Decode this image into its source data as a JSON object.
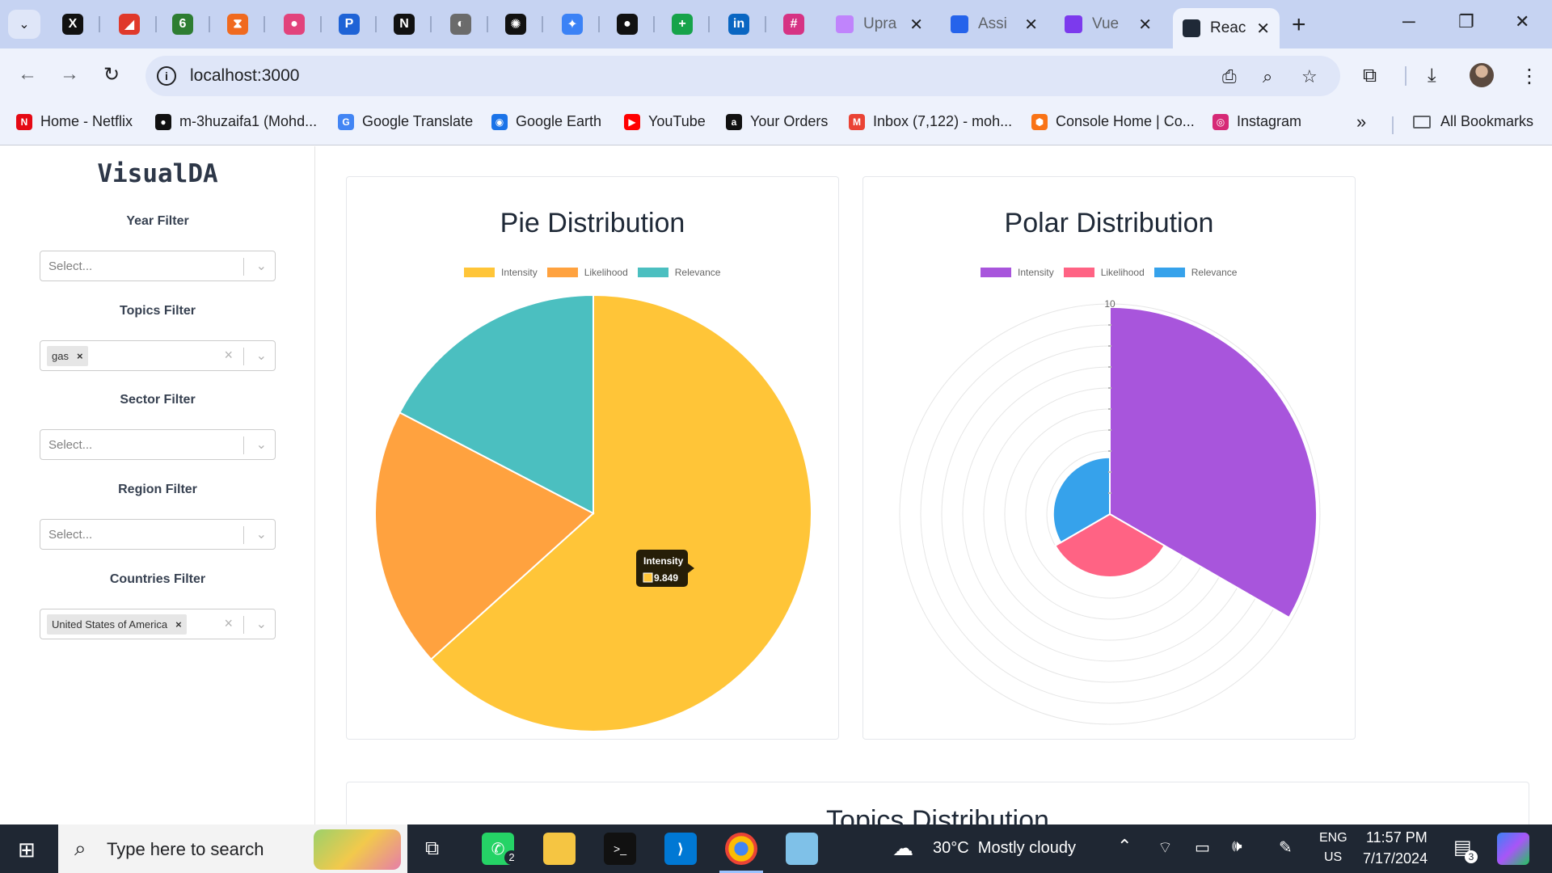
{
  "browser": {
    "pinned_tabs": [
      {
        "name": "x",
        "glyph": "X",
        "color": "#111111"
      },
      {
        "name": "ads",
        "glyph": "◢",
        "color": "#e0392b"
      },
      {
        "name": "gitlab",
        "glyph": "6",
        "color": "#2e7d32"
      },
      {
        "name": "hourglass",
        "glyph": "⧗",
        "color": "#f06a1f"
      },
      {
        "name": "figma",
        "glyph": "●",
        "color": "#e2437c"
      },
      {
        "name": "paypal",
        "glyph": "P",
        "color": "#1f63d6"
      },
      {
        "name": "notion",
        "glyph": "N",
        "color": "#111111"
      },
      {
        "name": "globe",
        "glyph": "◐",
        "color": "#6b6b6b"
      },
      {
        "name": "openai",
        "glyph": "✺",
        "color": "#111111"
      },
      {
        "name": "gemini",
        "glyph": "✦",
        "color": "#3b82f6"
      },
      {
        "name": "github",
        "glyph": "●",
        "color": "#111111"
      },
      {
        "name": "sheets-plus",
        "glyph": "+",
        "color": "#16a34a"
      },
      {
        "name": "linkedin",
        "glyph": "in",
        "color": "#0a66c2"
      },
      {
        "name": "slack",
        "glyph": "#",
        "color": "#d63384"
      }
    ],
    "tabs": [
      {
        "title": "Upra",
        "fav": "#c084fc"
      },
      {
        "title": "Assi",
        "fav": "#2563eb"
      },
      {
        "title": "Vue",
        "fav": "#7c3aed"
      },
      {
        "title": "Reac",
        "fav": "#1f2937"
      }
    ],
    "url": "localhost:3000",
    "bookmarks": [
      {
        "label": "Home - Netflix",
        "color": "#e50914",
        "glyph": "N"
      },
      {
        "label": "m-3huzaifa1 (Mohd...",
        "color": "#111111",
        "glyph": "●"
      },
      {
        "label": "Google Translate",
        "color": "#4285f4",
        "glyph": "G"
      },
      {
        "label": "Google Earth",
        "color": "#1a73e8",
        "glyph": "◉"
      },
      {
        "label": "YouTube",
        "color": "#ff0000",
        "glyph": "▶"
      },
      {
        "label": "Your Orders",
        "color": "#111111",
        "glyph": "a"
      },
      {
        "label": "Inbox (7,122) - moh...",
        "color": "#ea4335",
        "glyph": "M"
      },
      {
        "label": "Console Home | Co...",
        "color": "#f97316",
        "glyph": "⬢"
      },
      {
        "label": "Instagram",
        "color": "#d62976",
        "glyph": "◎"
      }
    ],
    "all_bookmarks": "All Bookmarks"
  },
  "sidebar": {
    "brand": "VisualDA",
    "filters": [
      {
        "label": "Year Filter",
        "placeholder": "Select...",
        "chip": ""
      },
      {
        "label": "Topics Filter",
        "placeholder": "",
        "chip": "gas"
      },
      {
        "label": "Sector Filter",
        "placeholder": "Select...",
        "chip": ""
      },
      {
        "label": "Region Filter",
        "placeholder": "Select...",
        "chip": ""
      },
      {
        "label": "Countries Filter",
        "placeholder": "",
        "chip": "United States of America"
      }
    ]
  },
  "pie_card": {
    "title": "Pie Distribution"
  },
  "polar_card": {
    "title": "Polar Distribution"
  },
  "topics_card": {
    "title": "Topics Distribution"
  },
  "chart_data": [
    {
      "type": "pie",
      "title": "Pie Distribution",
      "series": [
        {
          "name": "Intensity",
          "value": 9.849,
          "color": "#ffc538"
        },
        {
          "name": "Likelihood",
          "value": 3.0,
          "color": "#ffa23f"
        },
        {
          "name": "Relevance",
          "value": 2.7,
          "color": "#4bbfc0"
        }
      ],
      "legend": "top",
      "tooltip": {
        "label": "Intensity",
        "value": "9.849"
      }
    },
    {
      "type": "polar",
      "title": "Polar Distribution",
      "series": [
        {
          "name": "Intensity",
          "value": 9.849,
          "color": "#a855dc"
        },
        {
          "name": "Likelihood",
          "value": 3.0,
          "color": "#ff6384"
        },
        {
          "name": "Relevance",
          "value": 2.7,
          "color": "#36a2eb"
        }
      ],
      "r_max": 10,
      "r_label": "10",
      "legend": "top"
    }
  ],
  "taskbar": {
    "search_placeholder": "Type here to search",
    "whatsapp_badge": "2",
    "weather": "30°C  Mostly cloudy",
    "lang_top": "ENG",
    "lang_bottom": "US",
    "time": "11:57 PM",
    "date": "7/17/2024",
    "notif_badge": "3"
  }
}
